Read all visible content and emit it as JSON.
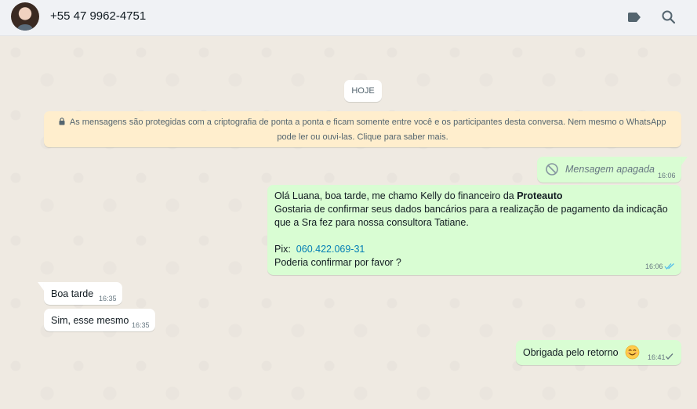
{
  "header": {
    "contact_name": "+55 47 9962-4751",
    "icons": [
      "label-icon",
      "search-icon"
    ]
  },
  "chat": {
    "date_chip": "HOJE",
    "encryption_line1": "As mensagens são protegidas com a criptografia de ponta a ponta e ficam somente entre você e os participantes desta conversa. Nem mesmo o WhatsApp",
    "encryption_line2": "pode ler ou ouvi-las. Clique para saber mais.",
    "messages": [
      {
        "direction": "out",
        "deleted": true,
        "text": "Mensagem apagada",
        "time": "16:06"
      },
      {
        "direction": "out",
        "line1_prefix": "Olá Luana, boa tarde, me chamo Kelly do financeiro da ",
        "line1_bold": "Proteauto",
        "line2": "Gostaria de confirmar seus dados bancários para a realização de pagamento da indicação",
        "line3": "que a Sra fez para nossa consultora Tatiane.",
        "pix_label": "Pix:",
        "pix_value": "060.422.069-31",
        "line5": "Poderia confirmar por favor ?",
        "time": "16:06",
        "status": "read"
      },
      {
        "direction": "in",
        "text": "Boa tarde",
        "time": "16:35"
      },
      {
        "direction": "in",
        "text": "Sim, esse mesmo",
        "time": "16:35"
      },
      {
        "direction": "out",
        "text": "Obrigada pelo retorno",
        "emoji": "smiling-face",
        "time": "16:41",
        "status": "sent"
      }
    ]
  },
  "colors": {
    "header_bg": "#f0f2f5",
    "chat_bg": "#efeae2",
    "outgoing_bubble": "#d9fdd3",
    "incoming_bubble": "#ffffff",
    "encryption_bg": "#ffeecd",
    "link": "#027eb5",
    "read_ticks": "#53bdeb"
  }
}
